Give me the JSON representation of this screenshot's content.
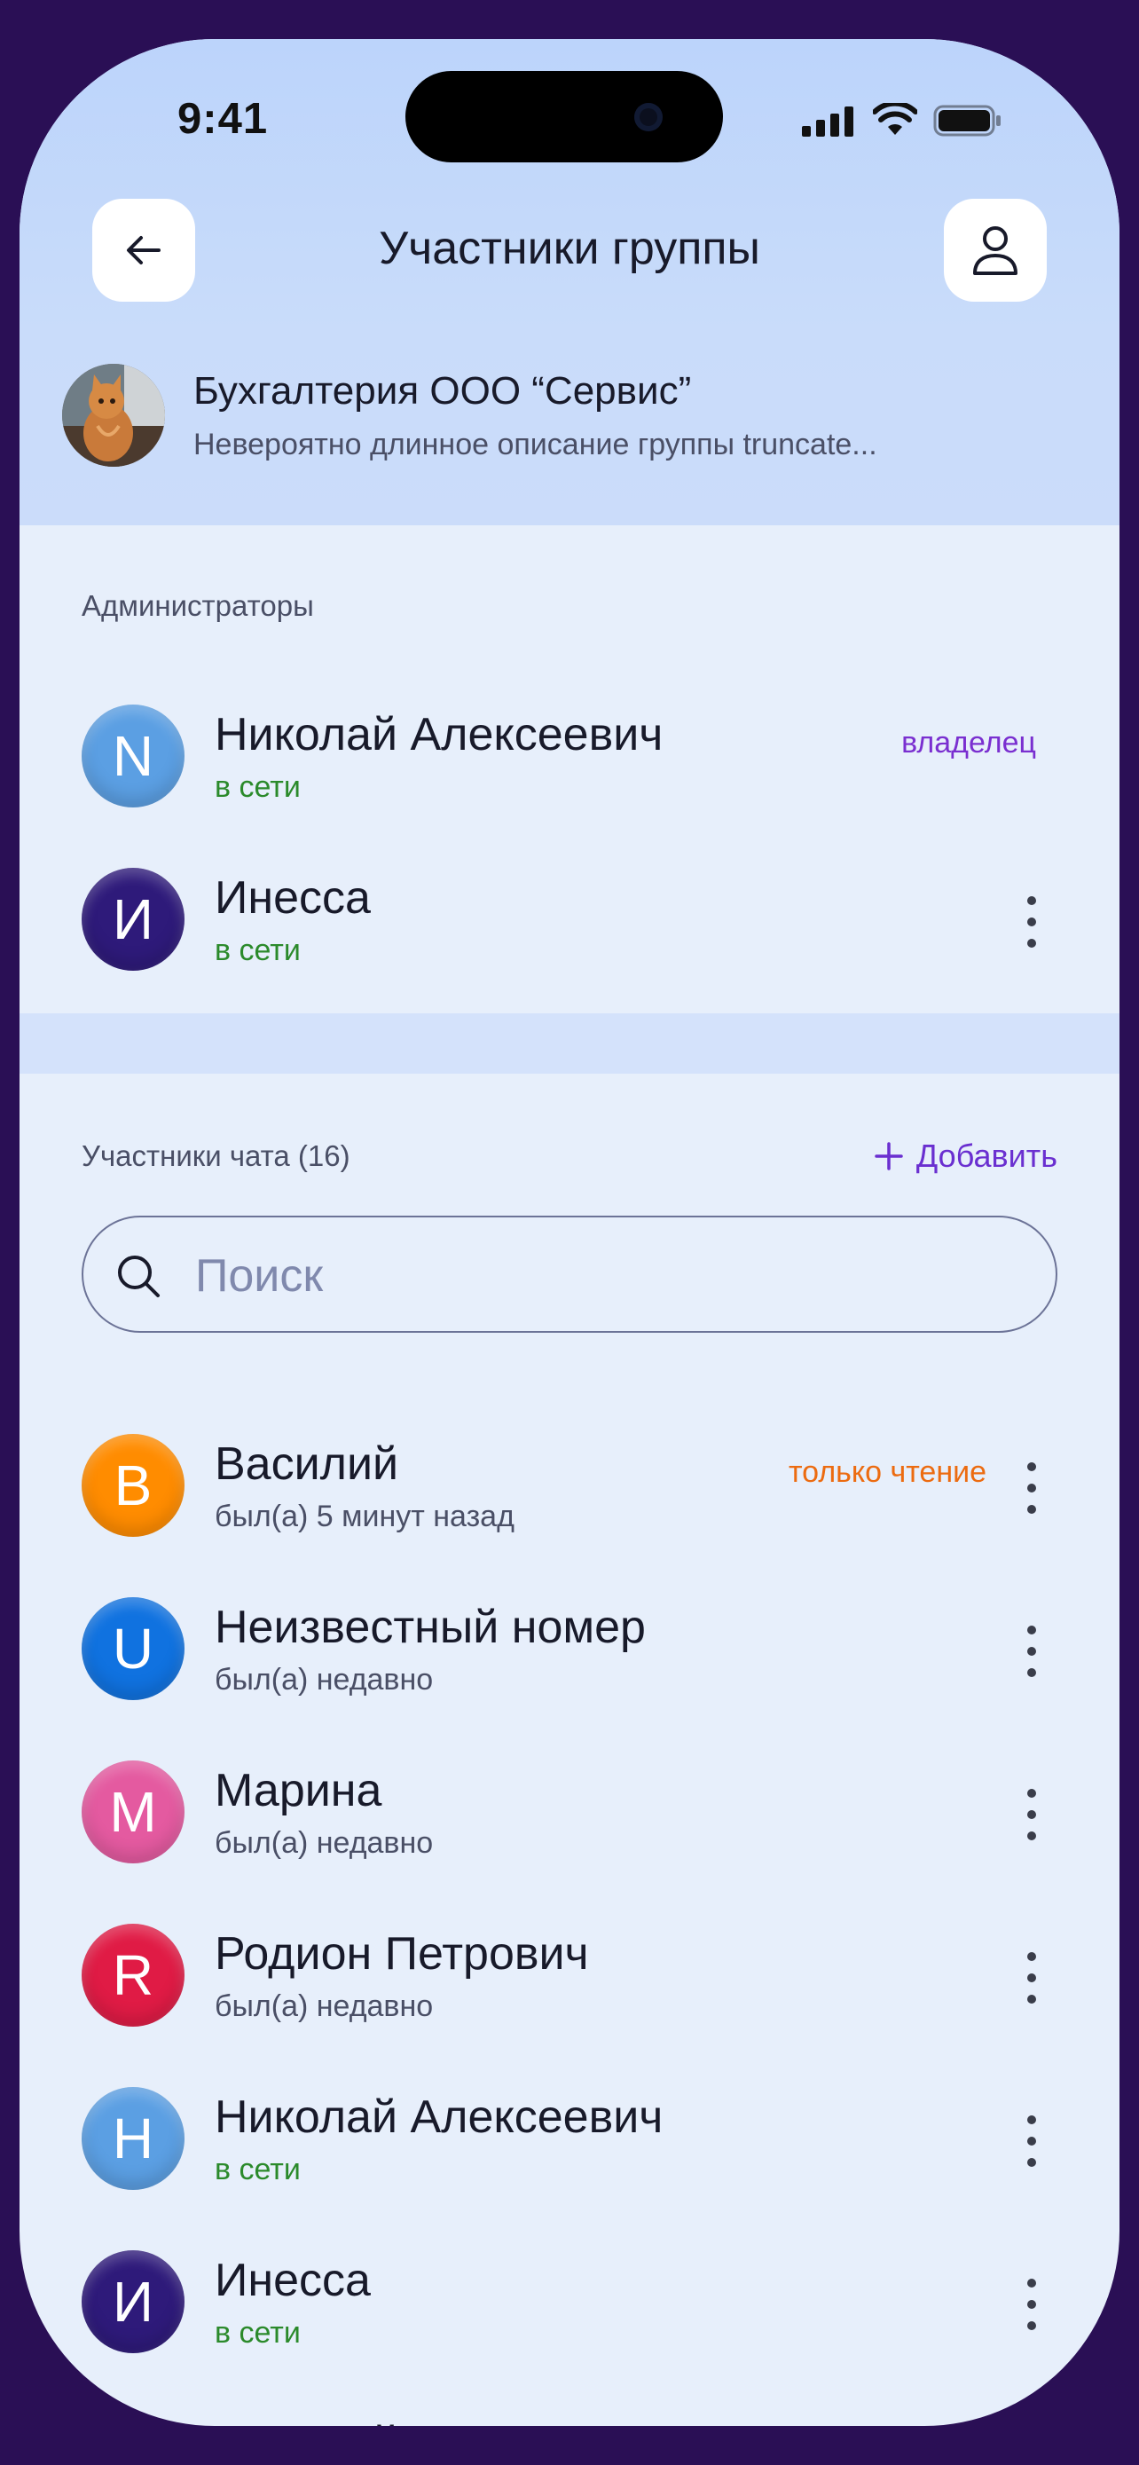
{
  "status_bar": {
    "time": "9:41"
  },
  "header": {
    "title": "Участники группы"
  },
  "group": {
    "name": "Бухгалтерия ООО “Сервис”",
    "description": "Невероятно длинное описание группы truncate..."
  },
  "admins": {
    "label": "Администраторы",
    "items": [
      {
        "initial": "N",
        "name": "Николай Алексеевич",
        "status": "в сети",
        "role": "владелец",
        "color": "#5b9fe3"
      },
      {
        "initial": "И",
        "name": "Инесса",
        "status": "в сети",
        "color": "#2e1a7a"
      }
    ]
  },
  "members": {
    "label": "Участники чата (16)",
    "add_label": "Добавить",
    "search_placeholder": "Поиск",
    "items": [
      {
        "initial": "В",
        "name": "Василий",
        "status": "был(а) 5 минут назад",
        "role": "только чтение",
        "color": "#ff8c00"
      },
      {
        "initial": "U",
        "name": "Неизвестный номер",
        "status": "был(а) недавно",
        "color": "#1072e0"
      },
      {
        "initial": "M",
        "name": "Марина",
        "status": "был(а) недавно",
        "color": "#e45aa0"
      },
      {
        "initial": "R",
        "name": "Родион Петрович",
        "status": "был(а) недавно",
        "color": "#e01b45"
      },
      {
        "initial": "Н",
        "name": "Николай Алексеевич",
        "status": "в сети",
        "color": "#5b9fe3"
      },
      {
        "initial": "И",
        "name": "Инесса",
        "status": "в сети",
        "color": "#2e1a7a"
      },
      {
        "initial": "В",
        "name": "Василий",
        "color": "#ff8c00"
      }
    ]
  }
}
